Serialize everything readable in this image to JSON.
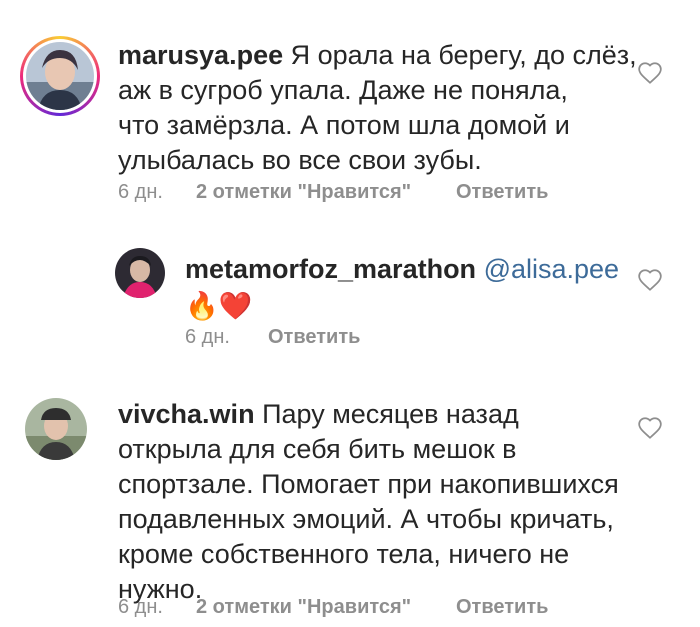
{
  "comments": [
    {
      "username": "marusya.pee",
      "text_lines": [
        "Я орала на берегу, до слёз,",
        "аж в сугроб упала. Даже не поняла,",
        "что замёрзла. А потом шла домой и",
        "улыбалась во все свои зубы."
      ],
      "time": "6 дн.",
      "likes": "2 отметки \"Нравится\"",
      "reply": "Ответить"
    },
    {
      "username": "metamorfoz_marathon",
      "mention": "@alisa.pee",
      "emoji": "🔥❤️",
      "time": "6 дн.",
      "reply": "Ответить"
    },
    {
      "username": "vivcha.win",
      "text_lines": [
        "Пару месяцев назад",
        "открыла для себя бить мешок в",
        "спортзале. Помогает при накопившихся",
        "подавленных эмоций. А чтобы кричать,",
        "кроме собственного тела, ничего не",
        "нужно."
      ],
      "time": "6 дн.",
      "likes": "2 отметки \"Нравится\"",
      "reply": "Ответить"
    }
  ],
  "colors": {
    "text": "#262626",
    "meta": "#8e8e8e",
    "mention": "#3d6b99"
  },
  "icons": {
    "like": "heart-outline-icon"
  }
}
